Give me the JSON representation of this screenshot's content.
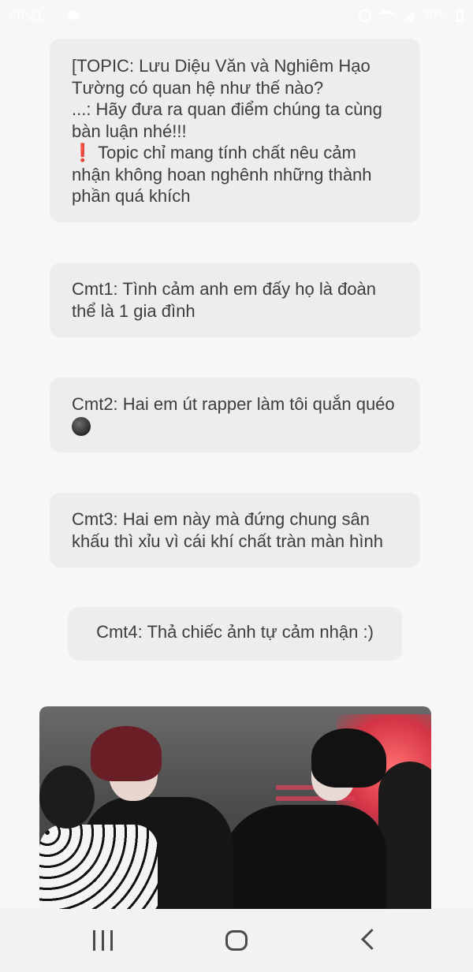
{
  "status_bar": {
    "time": "20:21",
    "battery": "39%"
  },
  "topic": {
    "line1": "[TOPIC: Lưu Diệu Văn và Nghiêm Hạo Tường có quan hệ như thế nào?",
    "line2": "...: Hãy đưa ra quan điểm chúng ta cùng bàn luận nhé!!!",
    "warning_icon": "❗",
    "line3": "Topic chỉ mang tính chất nêu cảm nhận không hoan nghênh những thành phần quá khích"
  },
  "comments": [
    {
      "text": "Cmt1: Tình cảm anh em đấy họ là đoàn thể là 1 gia đình"
    },
    {
      "text": "Cmt2: Hai em út rapper làm tôi quắn quéo"
    },
    {
      "text": "Cmt3: Hai em này mà đứng chung sân khấu thì xỉu vì cái khí chất tràn màn hình"
    },
    {
      "text": "Cmt4: Thả chiếc ảnh tự cảm nhận :)"
    }
  ],
  "icons": {
    "comment2_emoji": "new-moon-face-icon",
    "navigation": [
      "recent-apps-icon",
      "home-icon",
      "back-icon"
    ]
  }
}
